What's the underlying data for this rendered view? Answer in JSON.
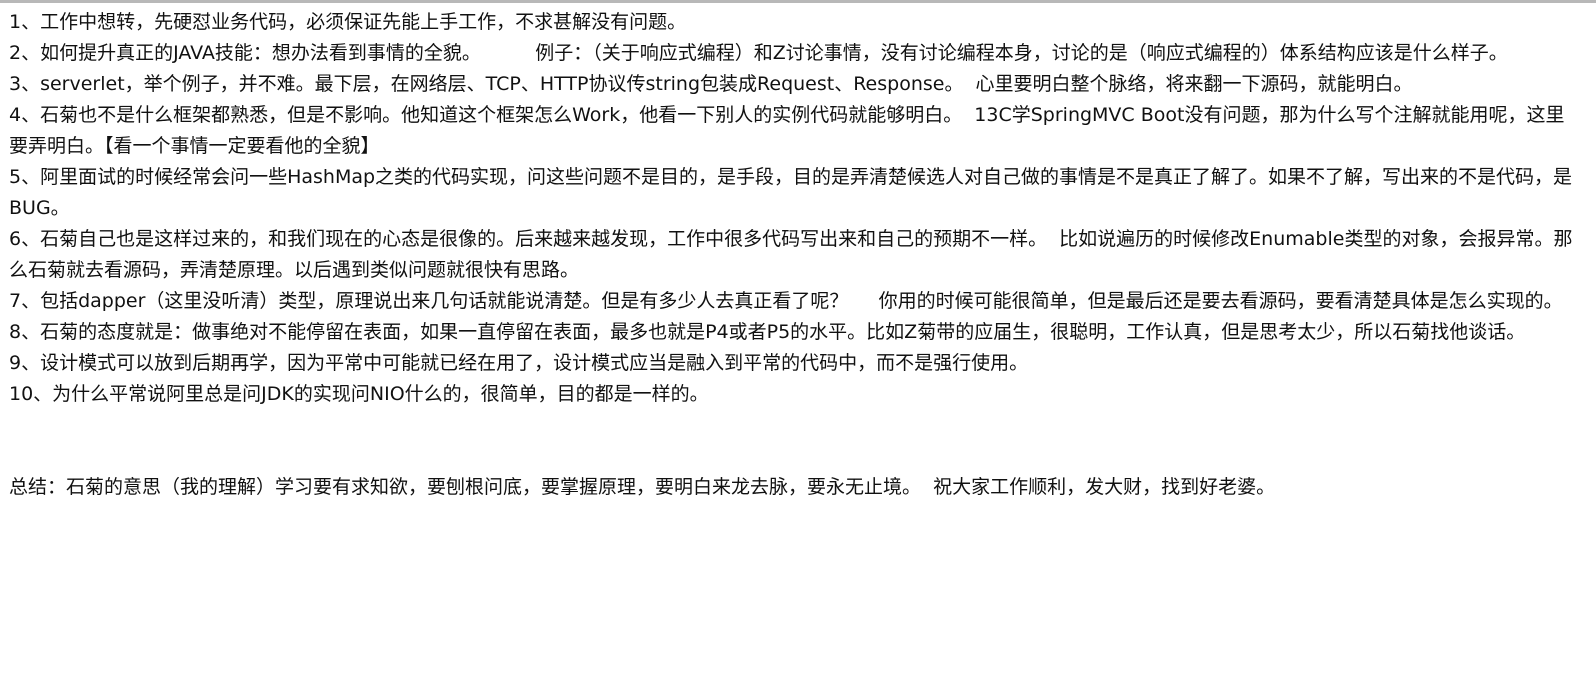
{
  "document": {
    "paragraphs": [
      "1、工作中想转，先硬怼业务代码，必须保证先能上手工作，不求甚解没有问题。",
      "2、如何提升真正的JAVA技能：想办法看到事情的全貌。         例子：（关于响应式编程）和Z讨论事情，没有讨论编程本身，讨论的是（响应式编程的）体系结构应该是什么样子。",
      "3、serverlet，举个例子，并不难。最下层，在网络层、TCP、HTTP协议传string包装成Request、Response。  心里要明白整个脉络，将来翻一下源码，就能明白。",
      "4、石菊也不是什么框架都熟悉，但是不影响。他知道这个框架怎么Work，他看一下别人的实例代码就能够明白。  13C学SpringMVC Boot没有问题，那为什么写个注解就能用呢，这里要弄明白。【看一个事情一定要看他的全貌】",
      "5、阿里面试的时候经常会问一些HashMap之类的代码实现，问这些问题不是目的，是手段，目的是弄清楚候选人对自己做的事情是不是真正了解了。如果不了解，写出来的不是代码，是BUG。",
      "6、石菊自己也是这样过来的，和我们现在的心态是很像的。后来越来越发现，工作中很多代码写出来和自己的预期不一样。  比如说遍历的时候修改Enumable类型的对象，会报异常。那么石菊就去看源码，弄清楚原理。以后遇到类似问题就很快有思路。",
      "7、包括dapper（这里没听清）类型，原理说出来几句话就能说清楚。但是有多少人去真正看了呢？     你用的时候可能很简单，但是最后还是要去看源码，要看清楚具体是怎么实现的。",
      "8、石菊的态度就是：做事绝对不能停留在表面，如果一直停留在表面，最多也就是P4或者P5的水平。比如Z菊带的应届生，很聪明，工作认真，但是思考太少，所以石菊找他谈话。",
      "9、设计模式可以放到后期再学，因为平常中可能就已经在用了，设计模式应当是融入到平常的代码中，而不是强行使用。",
      "10、为什么平常说阿里总是问JDK的实现问NIO什么的，很简单，目的都是一样的。"
    ],
    "summary": "总结：石菊的意思（我的理解）学习要有求知欲，要刨根问底，要掌握原理，要明白来龙去脉，要永无止境。  祝大家工作顺利，发大财，找到好老婆。"
  }
}
